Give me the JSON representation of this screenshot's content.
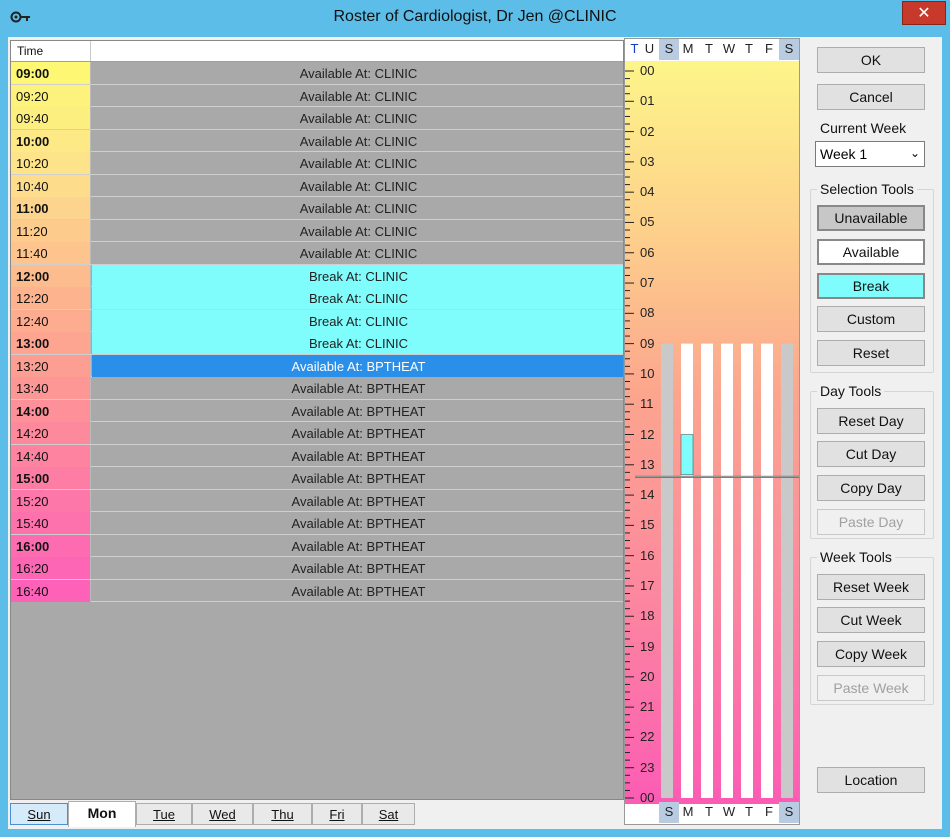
{
  "window": {
    "title": "Roster of Cardiologist, Dr Jen @CLINIC",
    "close_glyph": "✕"
  },
  "grid": {
    "header_time": "Time",
    "rows": [
      {
        "time": "09:00",
        "hour": true,
        "slot": "Available  At: CLINIC",
        "kind": "available"
      },
      {
        "time": "09:20",
        "hour": false,
        "slot": "Available  At: CLINIC",
        "kind": "available"
      },
      {
        "time": "09:40",
        "hour": false,
        "slot": "Available  At: CLINIC",
        "kind": "available"
      },
      {
        "time": "10:00",
        "hour": true,
        "slot": "Available  At: CLINIC",
        "kind": "available"
      },
      {
        "time": "10:20",
        "hour": false,
        "slot": "Available  At: CLINIC",
        "kind": "available"
      },
      {
        "time": "10:40",
        "hour": false,
        "slot": "Available  At: CLINIC",
        "kind": "available"
      },
      {
        "time": "11:00",
        "hour": true,
        "slot": "Available  At: CLINIC",
        "kind": "available"
      },
      {
        "time": "11:20",
        "hour": false,
        "slot": "Available  At: CLINIC",
        "kind": "available"
      },
      {
        "time": "11:40",
        "hour": false,
        "slot": "Available  At: CLINIC",
        "kind": "available"
      },
      {
        "time": "12:00",
        "hour": true,
        "slot": "Break  At: CLINIC",
        "kind": "break"
      },
      {
        "time": "12:20",
        "hour": false,
        "slot": "Break  At: CLINIC",
        "kind": "break"
      },
      {
        "time": "12:40",
        "hour": false,
        "slot": "Break  At: CLINIC",
        "kind": "break"
      },
      {
        "time": "13:00",
        "hour": true,
        "slot": "Break  At: CLINIC",
        "kind": "break"
      },
      {
        "time": "13:20",
        "hour": false,
        "slot": "Available  At: BPTHEAT",
        "kind": "selected"
      },
      {
        "time": "13:40",
        "hour": false,
        "slot": "Available  At: BPTHEAT",
        "kind": "available"
      },
      {
        "time": "14:00",
        "hour": true,
        "slot": "Available  At: BPTHEAT",
        "kind": "available"
      },
      {
        "time": "14:20",
        "hour": false,
        "slot": "Available  At: BPTHEAT",
        "kind": "available"
      },
      {
        "time": "14:40",
        "hour": false,
        "slot": "Available  At: BPTHEAT",
        "kind": "available"
      },
      {
        "time": "15:00",
        "hour": true,
        "slot": "Available  At: BPTHEAT",
        "kind": "available"
      },
      {
        "time": "15:20",
        "hour": false,
        "slot": "Available  At: BPTHEAT",
        "kind": "available"
      },
      {
        "time": "15:40",
        "hour": false,
        "slot": "Available  At: BPTHEAT",
        "kind": "available"
      },
      {
        "time": "16:00",
        "hour": true,
        "slot": "Available  At: BPTHEAT",
        "kind": "available"
      },
      {
        "time": "16:20",
        "hour": false,
        "slot": "Available  At: BPTHEAT",
        "kind": "available"
      },
      {
        "time": "16:40",
        "hour": false,
        "slot": "Available  At: BPTHEAT",
        "kind": "available"
      }
    ],
    "time_colors": [
      "#fdf774",
      "#fdf37c",
      "#fdee80",
      "#fde985",
      "#fde389",
      "#fddc8c",
      "#fdd48d",
      "#fdcc8d",
      "#fdc48e",
      "#fdbc8e",
      "#fdb48e",
      "#fdac8f",
      "#fda590",
      "#fd9e92",
      "#fd9795",
      "#fd9098",
      "#fd899c",
      "#fd83a0",
      "#fd7da4",
      "#fd77a8",
      "#fd71ac",
      "#fd6bb0",
      "#fd66b4",
      "#fd61b8"
    ]
  },
  "tabs": [
    {
      "label": "Sun",
      "state": "hover"
    },
    {
      "label": "Mon",
      "state": "active"
    },
    {
      "label": "Tue",
      "state": "normal"
    },
    {
      "label": "Wed",
      "state": "normal"
    },
    {
      "label": "Thu",
      "state": "normal"
    },
    {
      "label": "Fri",
      "state": "normal"
    },
    {
      "label": "Sat",
      "state": "normal"
    }
  ],
  "overview": {
    "header_days": [
      "T",
      "U",
      "S",
      "M",
      "T",
      "W",
      "T",
      "F",
      "S"
    ],
    "footer_days": [
      "S",
      "M",
      "T",
      "W",
      "T",
      "F",
      "S"
    ],
    "hour_labels": [
      "00",
      "01",
      "02",
      "03",
      "04",
      "05",
      "06",
      "07",
      "08",
      "09",
      "10",
      "11",
      "12",
      "13",
      "14",
      "15",
      "16",
      "17",
      "18",
      "19",
      "20",
      "21",
      "22",
      "23",
      "00"
    ],
    "colors": {
      "weekend": "#b8cbe0",
      "today": "#1a3ac8",
      "break": "#7ffcfc"
    }
  },
  "panel": {
    "ok": "OK",
    "cancel": "Cancel",
    "current_week_label": "Current Week",
    "current_week_value": "Week 1",
    "selection_tools_label": "Selection Tools",
    "unavailable": "Unavailable",
    "available": "Available",
    "break": "Break",
    "custom": "Custom",
    "reset": "Reset",
    "day_tools_label": "Day Tools",
    "reset_day": "Reset Day",
    "cut_day": "Cut Day",
    "copy_day": "Copy Day",
    "paste_day": "Paste Day",
    "week_tools_label": "Week Tools",
    "reset_week": "Reset Week",
    "cut_week": "Cut Week",
    "copy_week": "Copy Week",
    "paste_week": "Paste Week",
    "location": "Location"
  }
}
